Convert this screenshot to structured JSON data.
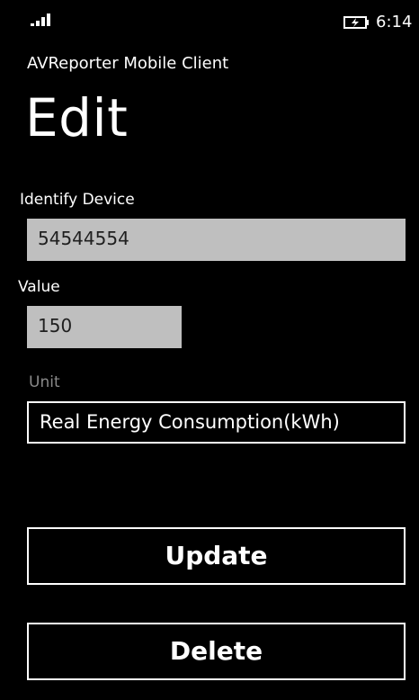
{
  "status_bar": {
    "time": "6:14",
    "signal_icon": "signal-strength-icon",
    "battery_icon": "battery-charging-icon"
  },
  "app_title": "AVReporter Mobile Client",
  "page_title": "Edit",
  "form": {
    "device_label": "Identify Device",
    "device_value": "54544554",
    "value_label": "Value",
    "value_value": "150",
    "unit_label": "Unit",
    "unit_value": "Real Energy Consumption(kWh)"
  },
  "buttons": {
    "update": "Update",
    "delete": "Delete"
  },
  "colors": {
    "background": "#000000",
    "textbox_fill": "#bfbfbf",
    "dim_label": "#8a8a8a"
  }
}
